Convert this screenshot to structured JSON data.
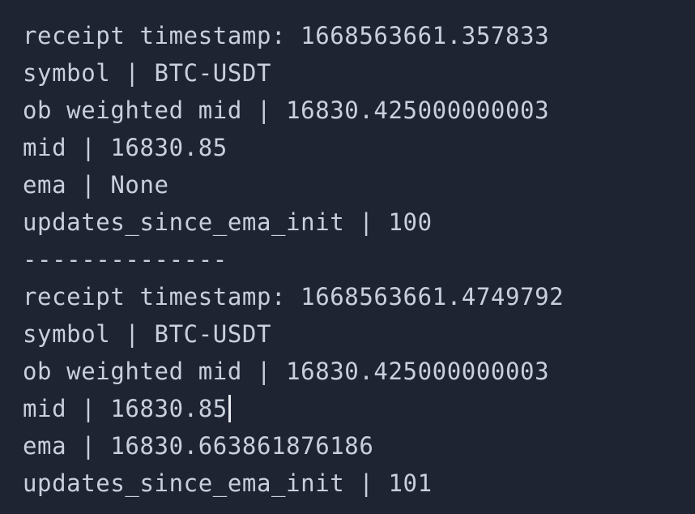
{
  "terminal": {
    "lines": [
      "--------------",
      "receipt timestamp: 1668563661.357833",
      "symbol | BTC-USDT",
      "ob weighted mid | 16830.425000000003",
      "mid | 16830.85",
      "ema | None",
      "updates_since_ema_init | 100",
      "--------------",
      "receipt timestamp: 1668563661.4749792",
      "symbol | BTC-USDT",
      "ob weighted mid | 16830.425000000003",
      "mid | 16830.85",
      "ema | 16830.663861876186",
      "updates_since_ema_init | 101"
    ]
  },
  "colors": {
    "background": "#1f2433",
    "text": "#c9d0dc",
    "cursor": "#e6e9ef"
  }
}
